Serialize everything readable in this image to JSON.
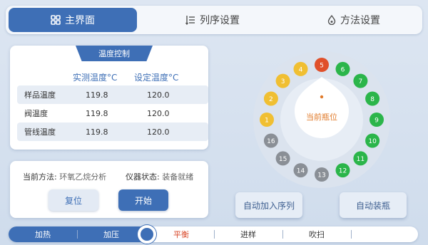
{
  "tabs": [
    {
      "label": "主界面",
      "icon": "grid-icon",
      "active": true
    },
    {
      "label": "列序设置",
      "icon": "sequence-list-icon",
      "active": false
    },
    {
      "label": "方法设置",
      "icon": "droplet-icon",
      "active": false
    }
  ],
  "temp": {
    "title": "温度控制",
    "col_actual": "实测温度°C",
    "col_set": "设定温度°C",
    "rows": [
      {
        "label": "样品温度",
        "actual": "119.8",
        "set": "120.0"
      },
      {
        "label": "阀温度",
        "actual": "119.8",
        "set": "120.0"
      },
      {
        "label": "管线温度",
        "actual": "119.8",
        "set": "120.0"
      }
    ]
  },
  "method": {
    "method_label": "当前方法:",
    "method_value": "环氧乙烷分析",
    "status_label": "仪器状态:",
    "status_value": "装备就绪",
    "reset_label": "复位",
    "start_label": "开始"
  },
  "tray": {
    "center_label": "当前瓶位",
    "positions": [
      {
        "n": "1",
        "color": "#f0bf32"
      },
      {
        "n": "2",
        "color": "#f0bf32"
      },
      {
        "n": "3",
        "color": "#f0bf32"
      },
      {
        "n": "4",
        "color": "#f0bf32"
      },
      {
        "n": "5",
        "color": "#e0502a"
      },
      {
        "n": "6",
        "color": "#2bb54a"
      },
      {
        "n": "7",
        "color": "#2bb54a"
      },
      {
        "n": "8",
        "color": "#2bb54a"
      },
      {
        "n": "9",
        "color": "#2bb54a"
      },
      {
        "n": "10",
        "color": "#2bb54a"
      },
      {
        "n": "11",
        "color": "#2bb54a"
      },
      {
        "n": "12",
        "color": "#2bb54a"
      },
      {
        "n": "13",
        "color": "#8a8f96"
      },
      {
        "n": "14",
        "color": "#8a8f96"
      },
      {
        "n": "15",
        "color": "#8a8f96"
      },
      {
        "n": "16",
        "color": "#8a8f96"
      }
    ]
  },
  "actions": {
    "auto_add_label": "自动加入序列",
    "auto_load_label": "自动装瓶"
  },
  "steps": [
    {
      "label": "加热",
      "state": "done"
    },
    {
      "label": "加压",
      "state": "done"
    },
    {
      "label": "平衡",
      "state": "current"
    },
    {
      "label": "进样",
      "state": "todo"
    },
    {
      "label": "吹扫",
      "state": "todo"
    }
  ],
  "colors": {
    "accent": "#3e6fb6",
    "current_step": "#d94a2b"
  }
}
